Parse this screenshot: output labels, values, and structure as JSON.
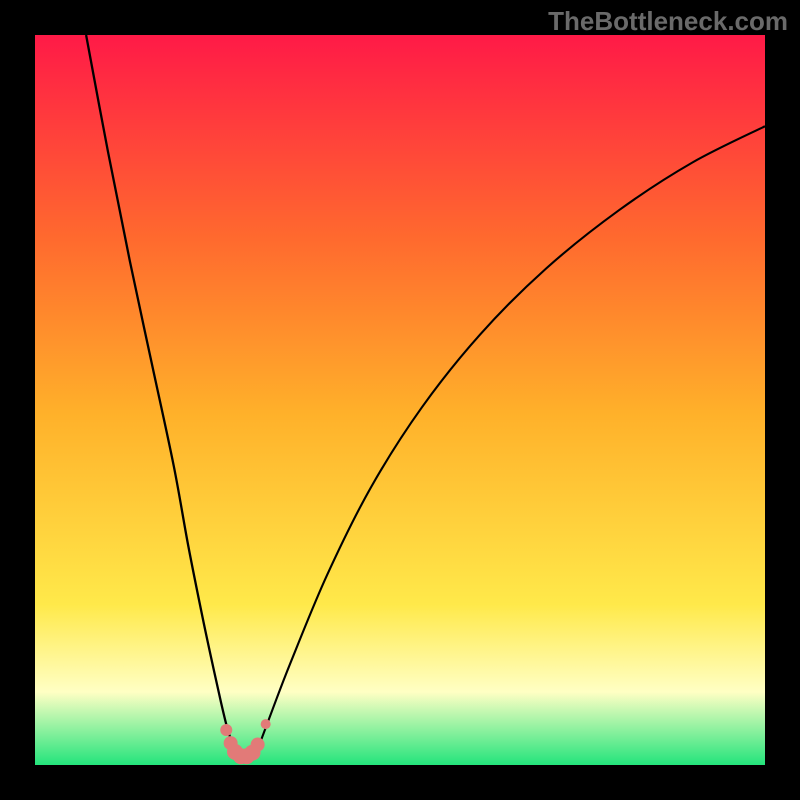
{
  "watermark": "TheBottleneck.com",
  "colors": {
    "border": "#000000",
    "gradient_top": "#ff1a47",
    "gradient_mid_upper": "#ff6a2e",
    "gradient_mid": "#ffb12a",
    "gradient_lower": "#ffe94a",
    "gradient_pale": "#ffffc4",
    "gradient_bottom": "#23e47c",
    "curve": "#000000",
    "marker_fill": "#e27a78",
    "marker_stroke": "#c6514f"
  },
  "chart_data": {
    "type": "line",
    "title": "",
    "xlabel": "",
    "ylabel": "",
    "xlim": [
      0,
      100
    ],
    "ylim": [
      0,
      100
    ],
    "series": [
      {
        "name": "left-curve",
        "x": [
          7,
          10,
          13,
          16,
          19,
          21,
          23,
          24.5,
          25.5,
          26.3,
          27,
          27.6
        ],
        "y": [
          100,
          84,
          69,
          55,
          41,
          30,
          20,
          13,
          8.5,
          5.2,
          3,
          1.5
        ]
      },
      {
        "name": "right-curve",
        "x": [
          30.2,
          31,
          32.5,
          35,
          40,
          46,
          53,
          61,
          70,
          80,
          90,
          100
        ],
        "y": [
          1.5,
          3.5,
          7.5,
          14,
          26,
          38,
          49,
          59,
          68,
          76,
          82.5,
          87.5
        ]
      }
    ],
    "markers": {
      "name": "optimum-cluster",
      "points": [
        {
          "x": 26.2,
          "y": 4.8,
          "r": 6
        },
        {
          "x": 26.8,
          "y": 3.0,
          "r": 7
        },
        {
          "x": 27.4,
          "y": 1.8,
          "r": 8
        },
        {
          "x": 28.2,
          "y": 1.2,
          "r": 8
        },
        {
          "x": 29.0,
          "y": 1.2,
          "r": 8
        },
        {
          "x": 29.8,
          "y": 1.7,
          "r": 8
        },
        {
          "x": 30.5,
          "y": 2.8,
          "r": 7
        },
        {
          "x": 31.6,
          "y": 5.6,
          "r": 5
        }
      ]
    }
  }
}
